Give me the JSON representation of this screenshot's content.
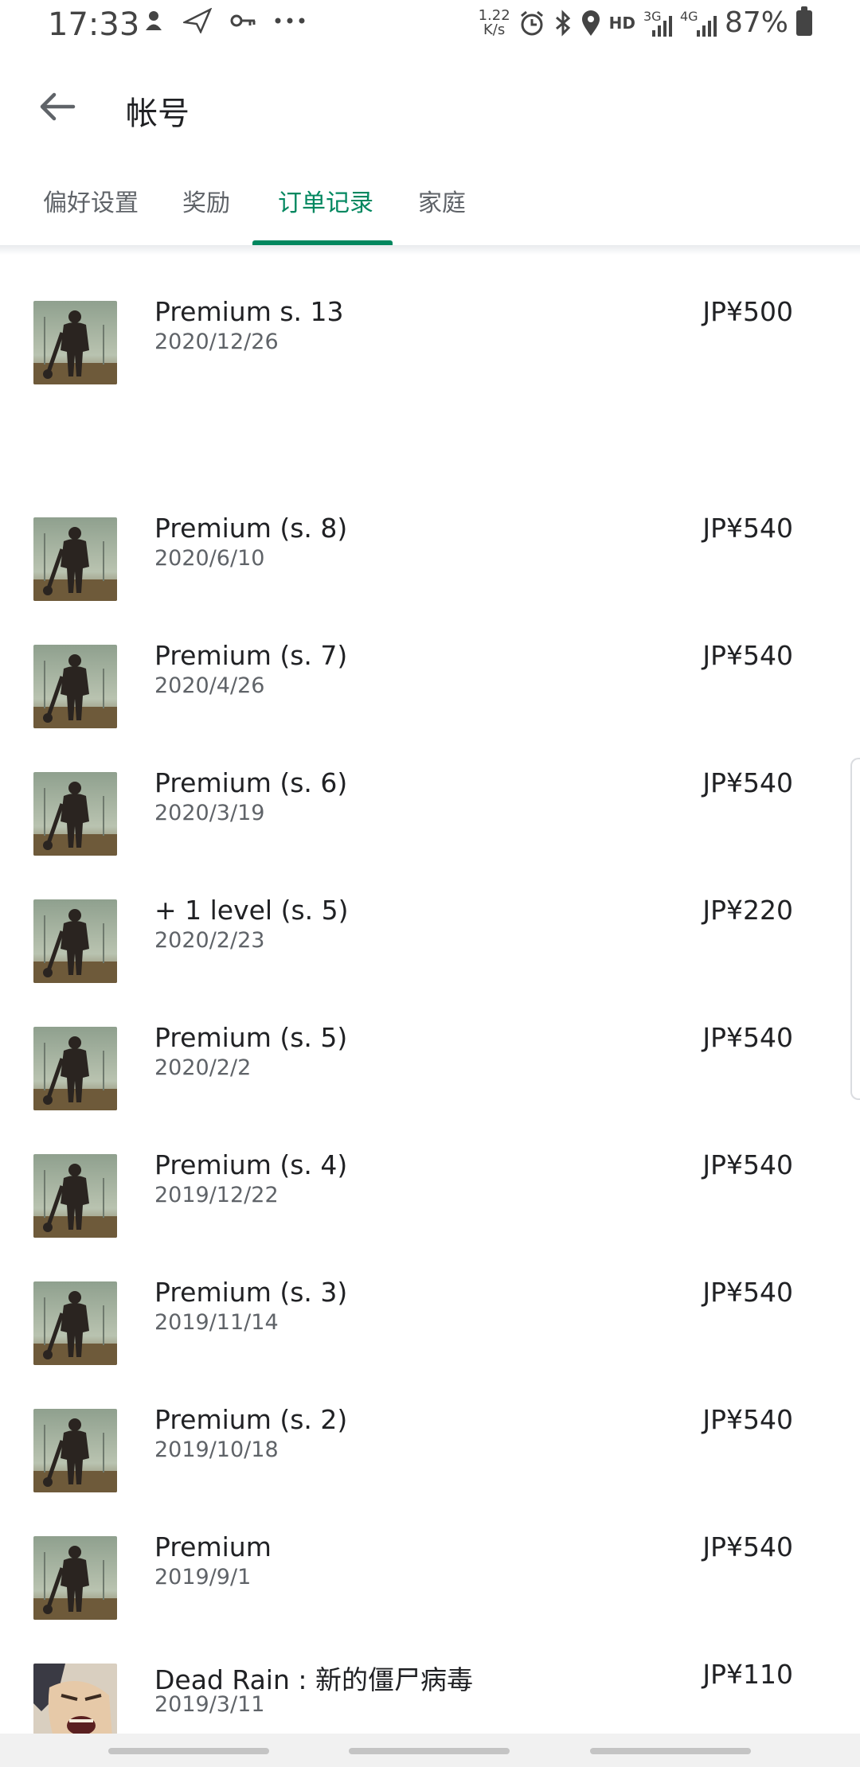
{
  "status": {
    "time": "17:33",
    "speed_top": "1.22",
    "speed_bottom": "K/s",
    "hd": "HD",
    "net3g": "3G",
    "net4g": "4G",
    "battery_pct": "87%",
    "left_icons": [
      "game-icon",
      "send-icon",
      "key-icon",
      "more-icon"
    ],
    "right_icons": [
      "alarm-icon",
      "bluetooth-icon",
      "location-icon"
    ]
  },
  "appbar": {
    "title": "帐号",
    "back_icon": "arrow-back-icon"
  },
  "tabs": [
    {
      "label": "偏好设置"
    },
    {
      "label": "奖励"
    },
    {
      "label": "订单记录",
      "active": true
    },
    {
      "label": "家庭"
    }
  ],
  "orders": [
    {
      "name": "Premium s. 13",
      "date": "2020/12/26",
      "price": "JP¥500",
      "icon": "soldier-thumbnail"
    },
    {
      "name": "Premium (s. 8)",
      "date": "2020/6/10",
      "price": "JP¥540",
      "icon": "soldier-thumbnail"
    },
    {
      "name": "Premium (s. 7)",
      "date": "2020/4/26",
      "price": "JP¥540",
      "icon": "soldier-thumbnail"
    },
    {
      "name": "Premium (s. 6)",
      "date": "2020/3/19",
      "price": "JP¥540",
      "icon": "soldier-thumbnail"
    },
    {
      "name": " + 1 level (s. 5)",
      "date": "2020/2/23",
      "price": "JP¥220",
      "icon": "soldier-thumbnail"
    },
    {
      "name": "Premium (s. 5)",
      "date": "2020/2/2",
      "price": "JP¥540",
      "icon": "soldier-thumbnail"
    },
    {
      "name": "Premium (s. 4)",
      "date": "2019/12/22",
      "price": "JP¥540",
      "icon": "soldier-thumbnail"
    },
    {
      "name": "Premium (s. 3)",
      "date": "2019/11/14",
      "price": "JP¥540",
      "icon": "soldier-thumbnail"
    },
    {
      "name": "Premium (s. 2)",
      "date": "2019/10/18",
      "price": "JP¥540",
      "icon": "soldier-thumbnail"
    },
    {
      "name": "Premium",
      "date": "2019/9/1",
      "price": "JP¥540",
      "icon": "soldier-thumbnail"
    },
    {
      "name": "Dead Rain : 新的僵尸病毒",
      "date": "2019/3/11",
      "price": "JP¥110",
      "icon": "zombie-thumbnail"
    }
  ],
  "colors": {
    "accent": "#01875f",
    "text": "#202124",
    "secondary": "#5f6368"
  }
}
